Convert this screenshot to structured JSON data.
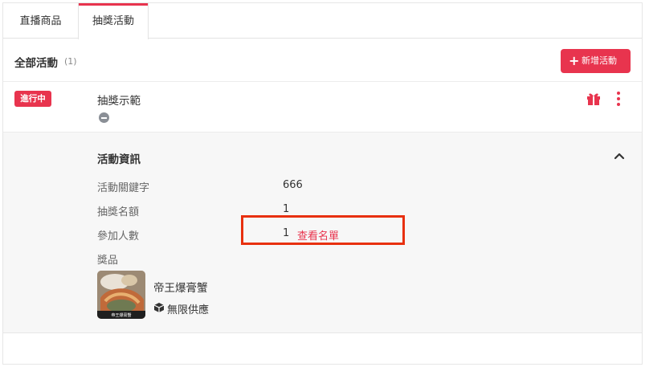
{
  "tabs": [
    {
      "label": "直播商品",
      "active": false
    },
    {
      "label": "抽獎活動",
      "active": true
    }
  ],
  "header": {
    "title": "全部活動",
    "count": "(1)",
    "add_button_label": "新增活動"
  },
  "event": {
    "status_badge": "進行中",
    "name": "抽獎示範"
  },
  "details": {
    "section_title": "活動資訊",
    "fields": {
      "keyword_label": "活動關鍵字",
      "keyword_value": "666",
      "winners_label": "抽獎名額",
      "winners_value": "1",
      "participants_label": "參加人數",
      "participants_value": "1",
      "view_list_link": "查看名單",
      "prize_label": "獎品"
    },
    "prize": {
      "name": "帝王爆膏蟹",
      "supply": "無限供應",
      "image_caption": "帝王爆膏蟹"
    }
  },
  "colors": {
    "accent": "#e8344e",
    "highlight_box": "#e8300f",
    "panel_bg": "#f7f7f7"
  },
  "icons": {
    "add": "plus-icon",
    "gift": "gift-icon",
    "more": "more-vertical-icon",
    "collapse": "chevron-up-icon",
    "paused": "minus-circle-icon",
    "stock": "box-icon"
  }
}
